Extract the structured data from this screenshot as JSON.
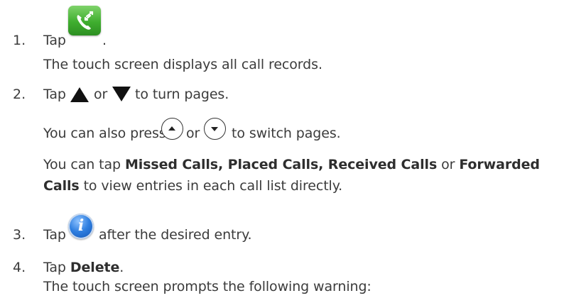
{
  "steps": [
    {
      "number": "1.",
      "prefix": "Tap",
      "suffix": ".",
      "lines": [
        "The touch screen displays all call records."
      ]
    },
    {
      "number": "2.",
      "prefix": "Tap",
      "middle": "or",
      "suffix": "to turn pages.",
      "press_prefix": "You can also press",
      "press_middle": "or",
      "press_suffix": "to switch pages.",
      "tap_prefix": "You can tap",
      "bold_1": "Missed Calls, Placed Calls, Received Calls",
      "tap_middle": "or",
      "bold_2": "Forwarded",
      "bold_3": "Calls",
      "tap_suffix": "to view entries in each call list directly."
    },
    {
      "number": "3.",
      "prefix": "Tap",
      "suffix": "after the desired entry."
    },
    {
      "number": "4.",
      "prefix": "Tap",
      "bold": "Delete",
      "suffix": ".",
      "lines": [
        "The touch screen prompts the following warning:"
      ]
    }
  ],
  "icons": {
    "call_log": "call-log-icon",
    "up": "up-triangle-icon",
    "down": "down-triangle-icon",
    "page_up": "page-up-key-icon",
    "page_down": "page-down-key-icon",
    "info": "info-icon"
  },
  "colors": {
    "text": "#3b3b3b",
    "icon_green": "#3fae2f",
    "info_blue": "#2f7fe0"
  }
}
